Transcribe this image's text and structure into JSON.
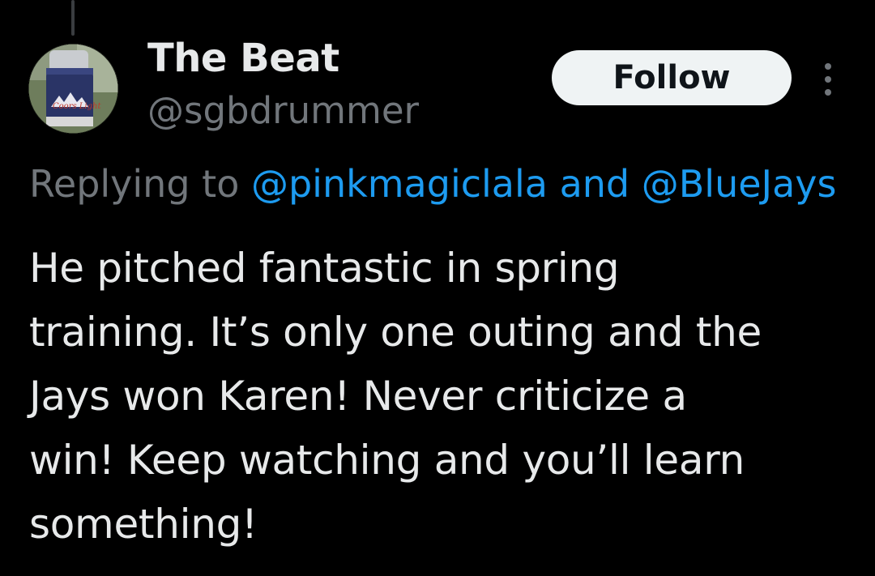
{
  "author": {
    "display_name": "The Beat",
    "handle": "@sgbdrummer",
    "avatar_label": "Coors Light"
  },
  "actions": {
    "follow_label": "Follow",
    "more_icon": "more-vertical-icon"
  },
  "reply": {
    "prefix": "Replying to ",
    "mention_1": "@pinkmagiclala",
    "joiner": " and ",
    "mention_2": "@BlueJays"
  },
  "tweet": {
    "text": "He pitched fantastic in spring\ntraining. It’s only one outing and the\nJays won Karen! Never criticize a\nwin! Keep watching and you’ll learn\nsomething!"
  },
  "colors": {
    "background": "#000000",
    "primary_text": "#e7e9ea",
    "secondary_text": "#71767b",
    "link": "#1d9bf0",
    "follow_button_bg": "#eff3f4"
  }
}
